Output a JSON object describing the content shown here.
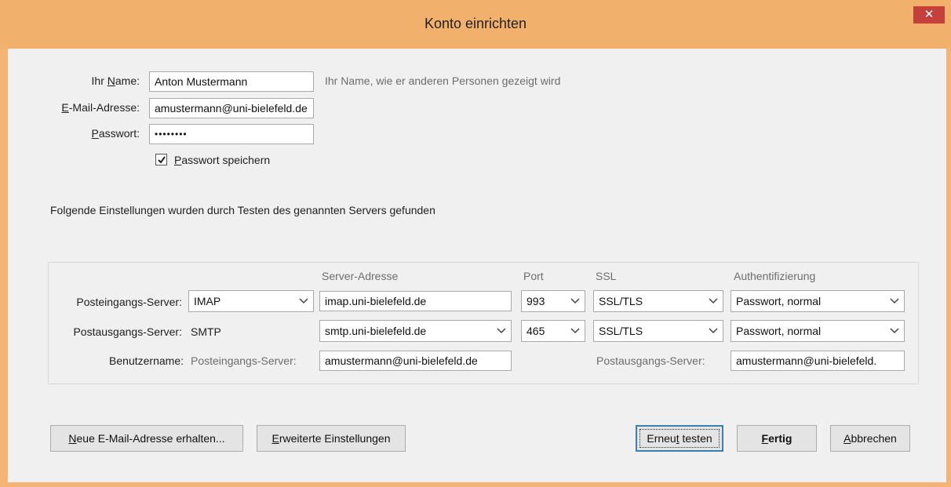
{
  "window": {
    "title": "Konto einrichten",
    "close_glyph": "✕"
  },
  "account": {
    "name_label_pre": "Ihr ",
    "name_label_ul": "N",
    "name_label_post": "ame:",
    "name_value": "Anton Mustermann",
    "name_hint": "Ihr Name, wie er anderen Personen gezeigt wird",
    "email_label_ul": "E",
    "email_label_post": "-Mail-Adresse:",
    "email_value": "amustermann@uni-bielefeld.de",
    "password_label_ul": "P",
    "password_label_post": "asswort:",
    "password_value": "••••••••",
    "save_password_checked": true,
    "save_password_ul": "P",
    "save_password_post": "asswort speichern"
  },
  "found_message": "Folgende Einstellungen wurden durch Testen des genannten Servers gefunden",
  "server": {
    "col_address": "Server-Adresse",
    "col_port": "Port",
    "col_ssl": "SSL",
    "col_auth": "Authentifizierung",
    "incoming": {
      "label": "Posteingangs-Server:",
      "protocol": "IMAP",
      "address": "imap.uni-bielefeld.de",
      "port": "993",
      "ssl": "SSL/TLS",
      "auth": "Passwort, normal"
    },
    "outgoing": {
      "label": "Postausgangs-Server:",
      "protocol": "SMTP",
      "address": "smtp.uni-bielefeld.de",
      "port": "465",
      "ssl": "SSL/TLS",
      "auth": "Passwort, normal"
    },
    "username": {
      "label": "Benutzername:",
      "incoming_label": "Posteingangs-Server:",
      "incoming_value": "amustermann@uni-bielefeld.de",
      "outgoing_label": "Postausgangs-Server:",
      "outgoing_value": "amustermann@uni-bielefeld."
    }
  },
  "buttons": {
    "new_email_ul": "N",
    "new_email_post": "eue E-Mail-Adresse erhalten...",
    "advanced_ul": "E",
    "advanced_post": "rweiterte Einstellungen",
    "retest_pre": "Erneu",
    "retest_ul": "t",
    "retest_post": " testen",
    "done_ul": "F",
    "done_post": "ertig",
    "cancel_ul": "A",
    "cancel_post": "bbrechen"
  },
  "colors": {
    "titlebar": "#f2b06d",
    "close": "#c6403b",
    "dialog_bg": "#f0f0f0",
    "default_button_border": "#3c7fb1"
  },
  "icons": {
    "close": "close-icon",
    "dropdown": "chevron-down-icon",
    "checkbox": "checkmark-icon"
  }
}
